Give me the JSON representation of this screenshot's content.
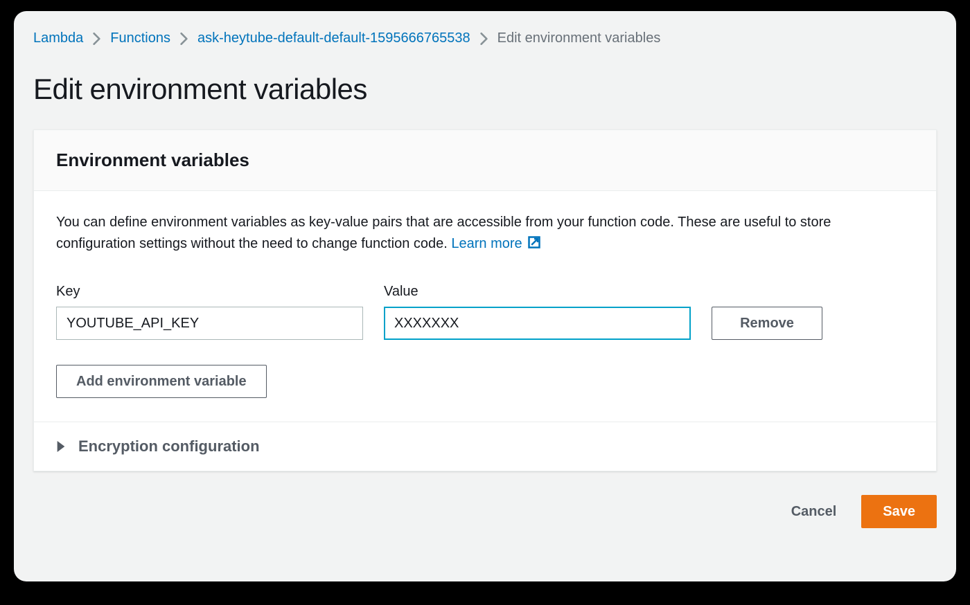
{
  "breadcrumb": {
    "items": [
      {
        "label": "Lambda",
        "link": true
      },
      {
        "label": "Functions",
        "link": true
      },
      {
        "label": "ask-heytube-default-default-1595666765538",
        "link": true
      },
      {
        "label": "Edit environment variables",
        "link": false
      }
    ]
  },
  "page": {
    "title": "Edit environment variables"
  },
  "panel": {
    "heading": "Environment variables",
    "description": "You can define environment variables as key-value pairs that are accessible from your function code. These are useful to store configuration settings without the need to change function code. ",
    "learn_more": "Learn more",
    "key_label": "Key",
    "value_label": "Value",
    "vars": [
      {
        "key": "YOUTUBE_API_KEY",
        "value": "XXXXXXX"
      }
    ],
    "remove_label": "Remove",
    "add_label": "Add environment variable",
    "encryption_section": "Encryption configuration"
  },
  "footer": {
    "cancel": "Cancel",
    "save": "Save"
  },
  "colors": {
    "link": "#0073bb",
    "primary": "#ec7211",
    "focus_border": "#00a1c9"
  }
}
